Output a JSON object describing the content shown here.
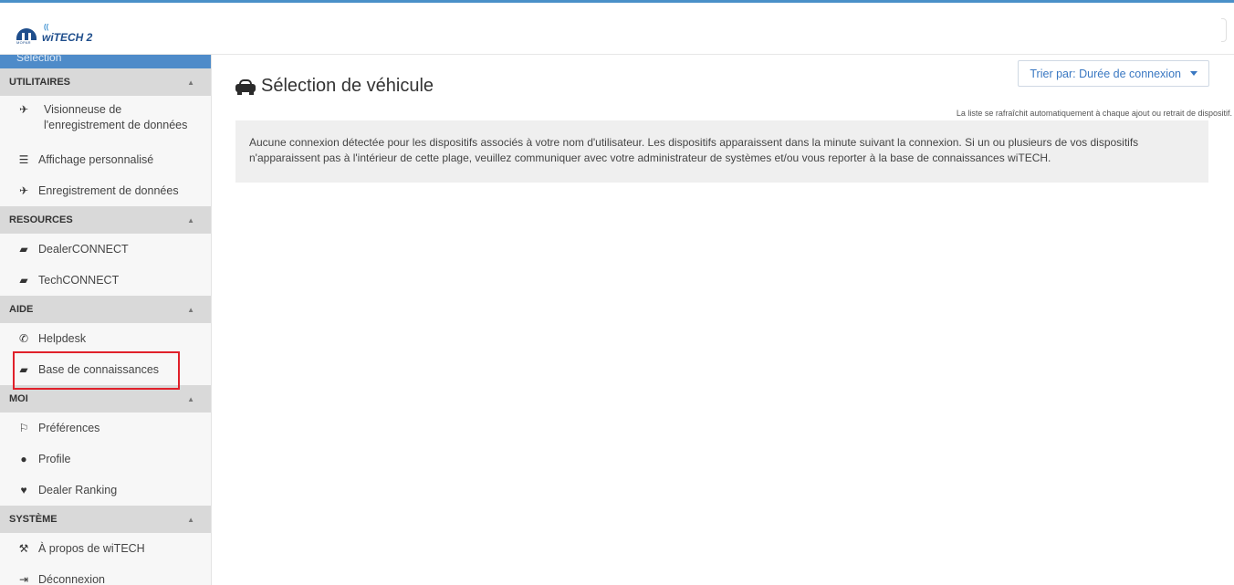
{
  "header": {
    "brand_small": "MOPAR",
    "brand": "wiTECH 2"
  },
  "sidebar": {
    "selection_strip": "Sélection",
    "sections": [
      {
        "title": "UTILITAIRES",
        "items": [
          {
            "icon": "plane-icon",
            "label": "Visionneuse de l'enregistrement de données"
          },
          {
            "icon": "list-icon",
            "label": "Affichage personnalisé"
          },
          {
            "icon": "plane-icon",
            "label": "Enregistrement de données"
          }
        ]
      },
      {
        "title": "RESOURCES",
        "items": [
          {
            "icon": "book-icon",
            "label": "DealerCONNECT"
          },
          {
            "icon": "book-icon",
            "label": "TechCONNECT"
          }
        ]
      },
      {
        "title": "AIDE",
        "items": [
          {
            "icon": "phone-icon",
            "label": "Helpdesk"
          },
          {
            "icon": "book-icon",
            "label": "Base de connaissances"
          }
        ]
      },
      {
        "title": "MOI",
        "items": [
          {
            "icon": "translate-icon",
            "label": "Préférences"
          },
          {
            "icon": "user-icon",
            "label": "Profile"
          },
          {
            "icon": "heartbeat-icon",
            "label": "Dealer Ranking"
          }
        ]
      },
      {
        "title": "SYSTÈME",
        "items": [
          {
            "icon": "gavel-icon",
            "label": "À propos de wiTECH"
          },
          {
            "icon": "sign-out-icon",
            "label": "Déconnexion"
          }
        ]
      }
    ]
  },
  "main": {
    "title": "Sélection de véhicule",
    "sort_label": "Trier par: Durée de connexion",
    "refresh_note": "La liste se rafraîchit automatiquement à chaque ajout ou retrait de dispositif.",
    "info_message": "Aucune connexion détectée pour les dispositifs associés à votre nom d'utilisateur. Les dispositifs apparaissent dans la minute suivant la connexion. Si un ou plusieurs de vos dispositifs n'apparaissent pas à l'intérieur de cette plage, veuillez communiquer avec votre administrateur de systèmes et/ou vous reporter à la base de connaissances wiTECH."
  },
  "colors": {
    "accent": "#4a90c8",
    "link": "#3a78c2",
    "highlight": "#e0202a"
  }
}
